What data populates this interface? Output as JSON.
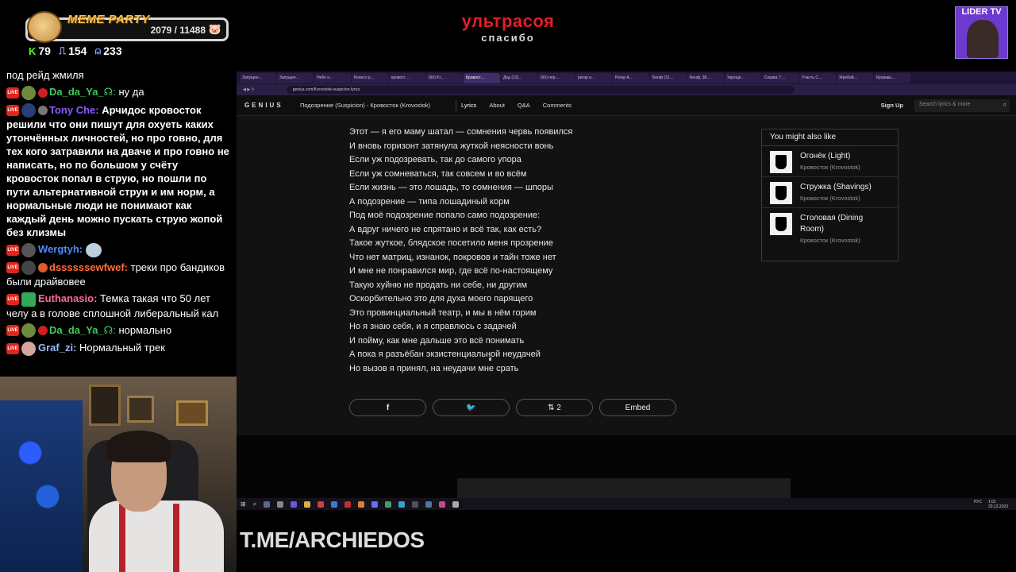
{
  "overlay": {
    "badge_title": "MEME PARTY",
    "badge_count": "2079 / 11488",
    "headline_main": "ультрасоя",
    "headline_sub": "спасибо",
    "stats": {
      "kick": "79",
      "twitch": "154",
      "viewers": "233"
    },
    "lider_title": "LIDER TV",
    "watermark": "T.ME/ARCHIEDOS"
  },
  "chat": [
    {
      "user": "",
      "text": "под рейд жмиля"
    },
    {
      "user": "Da_da_Ya_",
      "suffix": "☊:",
      "text": "ну да"
    },
    {
      "user": "Tony Che:",
      "text": "Арчидос  кровосток решили что они пишут для охуеть каких утончённых личностей, но про говно, для тех кого затравили на дваче и про говно не написать, но по большом у счёту кровосток попал в струю, но пошли по пути альтернативной струи и им норм, а нормальные люди не понимают как каждый день можно пускать струю жопой без клизмы"
    },
    {
      "user": "Wergtyh:",
      "text": ""
    },
    {
      "user": "dssssssewfwef:",
      "text": "треки про бандиков были драйвовее"
    },
    {
      "user": "Euthanasio:",
      "text": "Темка такая что 50 лет челу а в голове сплошной либеральный кал"
    },
    {
      "user": "Da_da_Ya_",
      "suffix": "☊:",
      "text": "нормально"
    },
    {
      "user": "Graf_zi:",
      "text": "Нормальный трек"
    }
  ],
  "browser": {
    "tabs": [
      "Запущен…",
      "Запущен…",
      "Небо н…",
      "Колесо р…",
      "кровост…",
      "(60) Kr…",
      "Кровост…",
      "Дед (13)…",
      "(60) пер…",
      "регар и…",
      "Регар А…",
      "Бенф (31…",
      "Бенф, 38…",
      "Укроще…",
      "Сказка: Г…",
      "Участь С…",
      "Жребий…",
      "Кровавь…"
    ],
    "url": "genius.com/Krovostok-suspicion-lyrics",
    "genius": {
      "logo": "GENIUS",
      "song": "Подозрение (Suspicion) - Кровосток (Krovostok)",
      "nav": [
        "Lyrics",
        "About",
        "Q&A",
        "Comments"
      ],
      "signup": "Sign Up",
      "search_placeholder": "Search lyrics & more"
    },
    "lyrics": [
      "Этот — я его маму шатал — сомнения червь появился",
      "И вновь горизонт затянула жуткой неясности вонь",
      "Если уж подозревать, так до самого упора",
      "Если уж сомневаться, так совсем и во всём",
      "Если жизнь — это лошадь, то сомнения — шпоры",
      "А подозрение — типа лошадиный корм",
      "Под моё подозрение попало само подозрение:",
      "А вдруг ничего не спрятано и всё так, как есть?",
      "Такое жуткое, блядское посетило меня прозрение",
      "Что нет матриц, изнанок, покровов и тайн тоже нет",
      "И мне не понравился мир, где всё по-настоящему",
      "Такую хуйню не продать ни себе, ни другим",
      "Оскорбительно это для духа моего парящего",
      "Это провинциальный театр, и мы в нём горим",
      "Но я знаю себя, и я справлюсь с задачей",
      "И пойму, как мне дальше это всё понимать",
      "А пока я разъёбан экзистенциальной неудачей",
      "Но вызов я принял, на неудачи мне срать"
    ],
    "also_like": {
      "title": "You might also like",
      "items": [
        {
          "title": "Огонёк (Light)",
          "artist": "Кровосток (Krovostok)"
        },
        {
          "title": "Стружка (Shavings)",
          "artist": "Кровосток (Krovostok)"
        },
        {
          "title": "Столовая (Dining Room)",
          "artist": "Кровосток (Krovostok)"
        }
      ]
    },
    "share": {
      "facebook": "f",
      "twitter": "🐦",
      "upvotes": "2",
      "embed": "Embed"
    },
    "taskbar": {
      "lang": "РУС",
      "time": "1:01",
      "date": "29.12.2023"
    }
  }
}
